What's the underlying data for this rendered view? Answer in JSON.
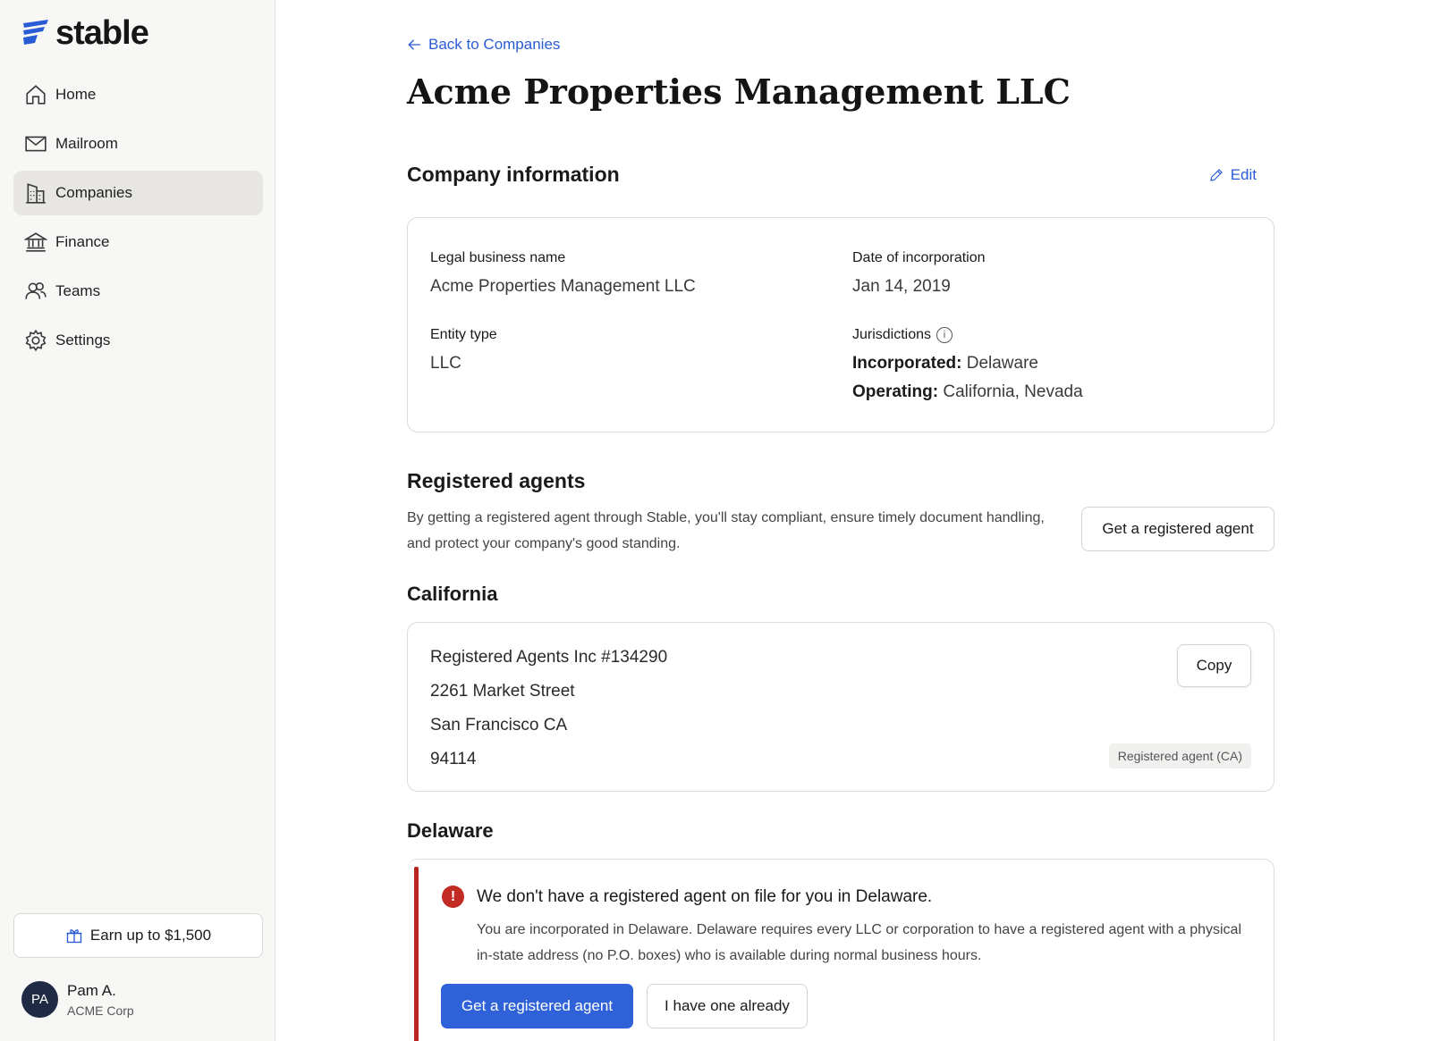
{
  "brand": {
    "name": "stable",
    "accent": "#2a5bd7"
  },
  "sidebar": {
    "items": [
      {
        "label": "Home",
        "icon": "home-icon"
      },
      {
        "label": "Mailroom",
        "icon": "mail-icon"
      },
      {
        "label": "Companies",
        "icon": "building-icon",
        "active": true
      },
      {
        "label": "Finance",
        "icon": "bank-icon"
      },
      {
        "label": "Teams",
        "icon": "users-icon"
      },
      {
        "label": "Settings",
        "icon": "gear-icon"
      }
    ],
    "earn_label": "Earn up to $1,500",
    "user": {
      "initials": "PA",
      "name": "Pam A.",
      "org": "ACME Corp"
    }
  },
  "page": {
    "back_label": "Back to Companies",
    "title": "Acme Properties Management LLC"
  },
  "company_info": {
    "heading": "Company information",
    "edit_label": "Edit",
    "legal_name_label": "Legal business name",
    "legal_name_value": "Acme Properties Management LLC",
    "date_label": "Date of incorporation",
    "date_value": "Jan 14, 2019",
    "entity_label": "Entity type",
    "entity_value": "LLC",
    "jurisdictions_label": "Jurisdictions",
    "incorporated_label": "Incorporated:",
    "incorporated_value": "Delaware",
    "operating_label": "Operating:",
    "operating_value": "California, Nevada"
  },
  "registered_agents": {
    "heading": "Registered agents",
    "description": "By getting a registered agent through Stable, you'll stay compliant, ensure timely document handling, and protect your company's good standing.",
    "cta_label": "Get a registered agent"
  },
  "california": {
    "heading": "California",
    "address": [
      "Registered Agents Inc #134290",
      "2261 Market Street",
      "San Francisco CA",
      "94114"
    ],
    "copy_label": "Copy",
    "badge": "Registered agent (CA)"
  },
  "delaware": {
    "heading": "Delaware",
    "alert_title": "We don't have a registered agent on file for you in Delaware.",
    "alert_body": "You are incorporated in Delaware. Delaware requires every LLC or corporation to have a registered agent with a physical in-state address (no P.O. boxes) who is available during normal business hours.",
    "primary_label": "Get a registered agent",
    "secondary_label": "I have one already",
    "alert_color": "#b8251f"
  }
}
